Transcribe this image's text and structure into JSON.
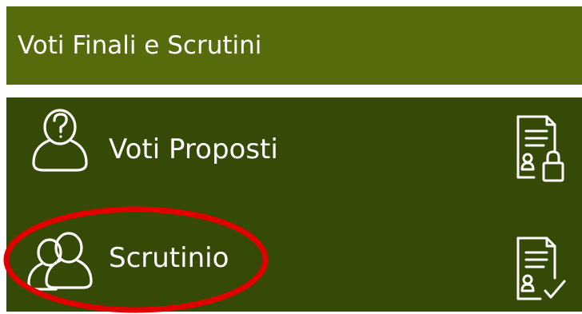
{
  "header": {
    "title": "Voti Finali e Scrutini"
  },
  "menu": {
    "items": [
      {
        "label": "Voti Proposti",
        "icon": "person-question-icon",
        "action_icon": "document-lock-icon"
      },
      {
        "label": "Scrutinio",
        "icon": "people-icon",
        "action_icon": "document-check-icon"
      }
    ]
  },
  "colors": {
    "header_bg": "#556b0c",
    "panel_bg": "#364a08",
    "text": "#ffffff",
    "highlight": "#e00000"
  }
}
